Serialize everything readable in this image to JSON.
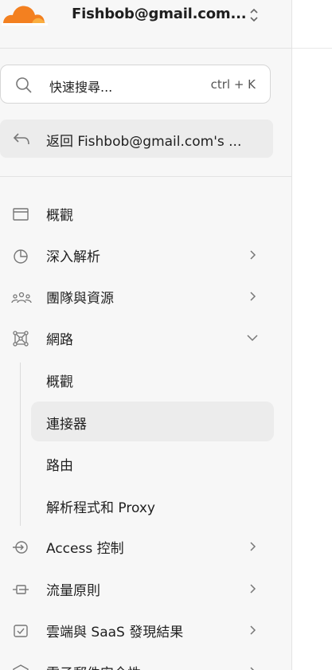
{
  "account": {
    "name": "Fishbob@gmail.com..."
  },
  "search": {
    "placeholder": "快速搜尋...",
    "shortcut": "ctrl + K"
  },
  "back": {
    "label": "返回 Fishbob@gmail.com's ..."
  },
  "nav": [
    {
      "label": "概觀",
      "icon": "window-icon",
      "expandable": false
    },
    {
      "label": "深入解析",
      "icon": "pie-chart-icon",
      "expandable": true
    },
    {
      "label": "團隊與資源",
      "icon": "people-group-icon",
      "expandable": true
    },
    {
      "label": "網路",
      "icon": "network-icon",
      "expandable": true,
      "expanded": true,
      "children": [
        {
          "label": "概觀",
          "active": false
        },
        {
          "label": "連接器",
          "active": true
        },
        {
          "label": "路由",
          "active": false
        },
        {
          "label": "解析程式和 Proxy",
          "active": false
        }
      ]
    },
    {
      "label": "Access 控制",
      "icon": "access-icon",
      "expandable": true
    },
    {
      "label": "流量原則",
      "icon": "traffic-policy-icon",
      "expandable": true
    },
    {
      "label": "雲端與 SaaS 發現結果",
      "icon": "cloud-findings-icon",
      "expandable": true
    },
    {
      "label": "電子郵件安全性",
      "icon": "email-security-icon",
      "expandable": true
    }
  ],
  "colors": {
    "brand_orange": "#f38020",
    "brand_orange_light": "#faae40",
    "sidebar_bg": "#f7f7f7",
    "active_bg": "#ececec"
  }
}
